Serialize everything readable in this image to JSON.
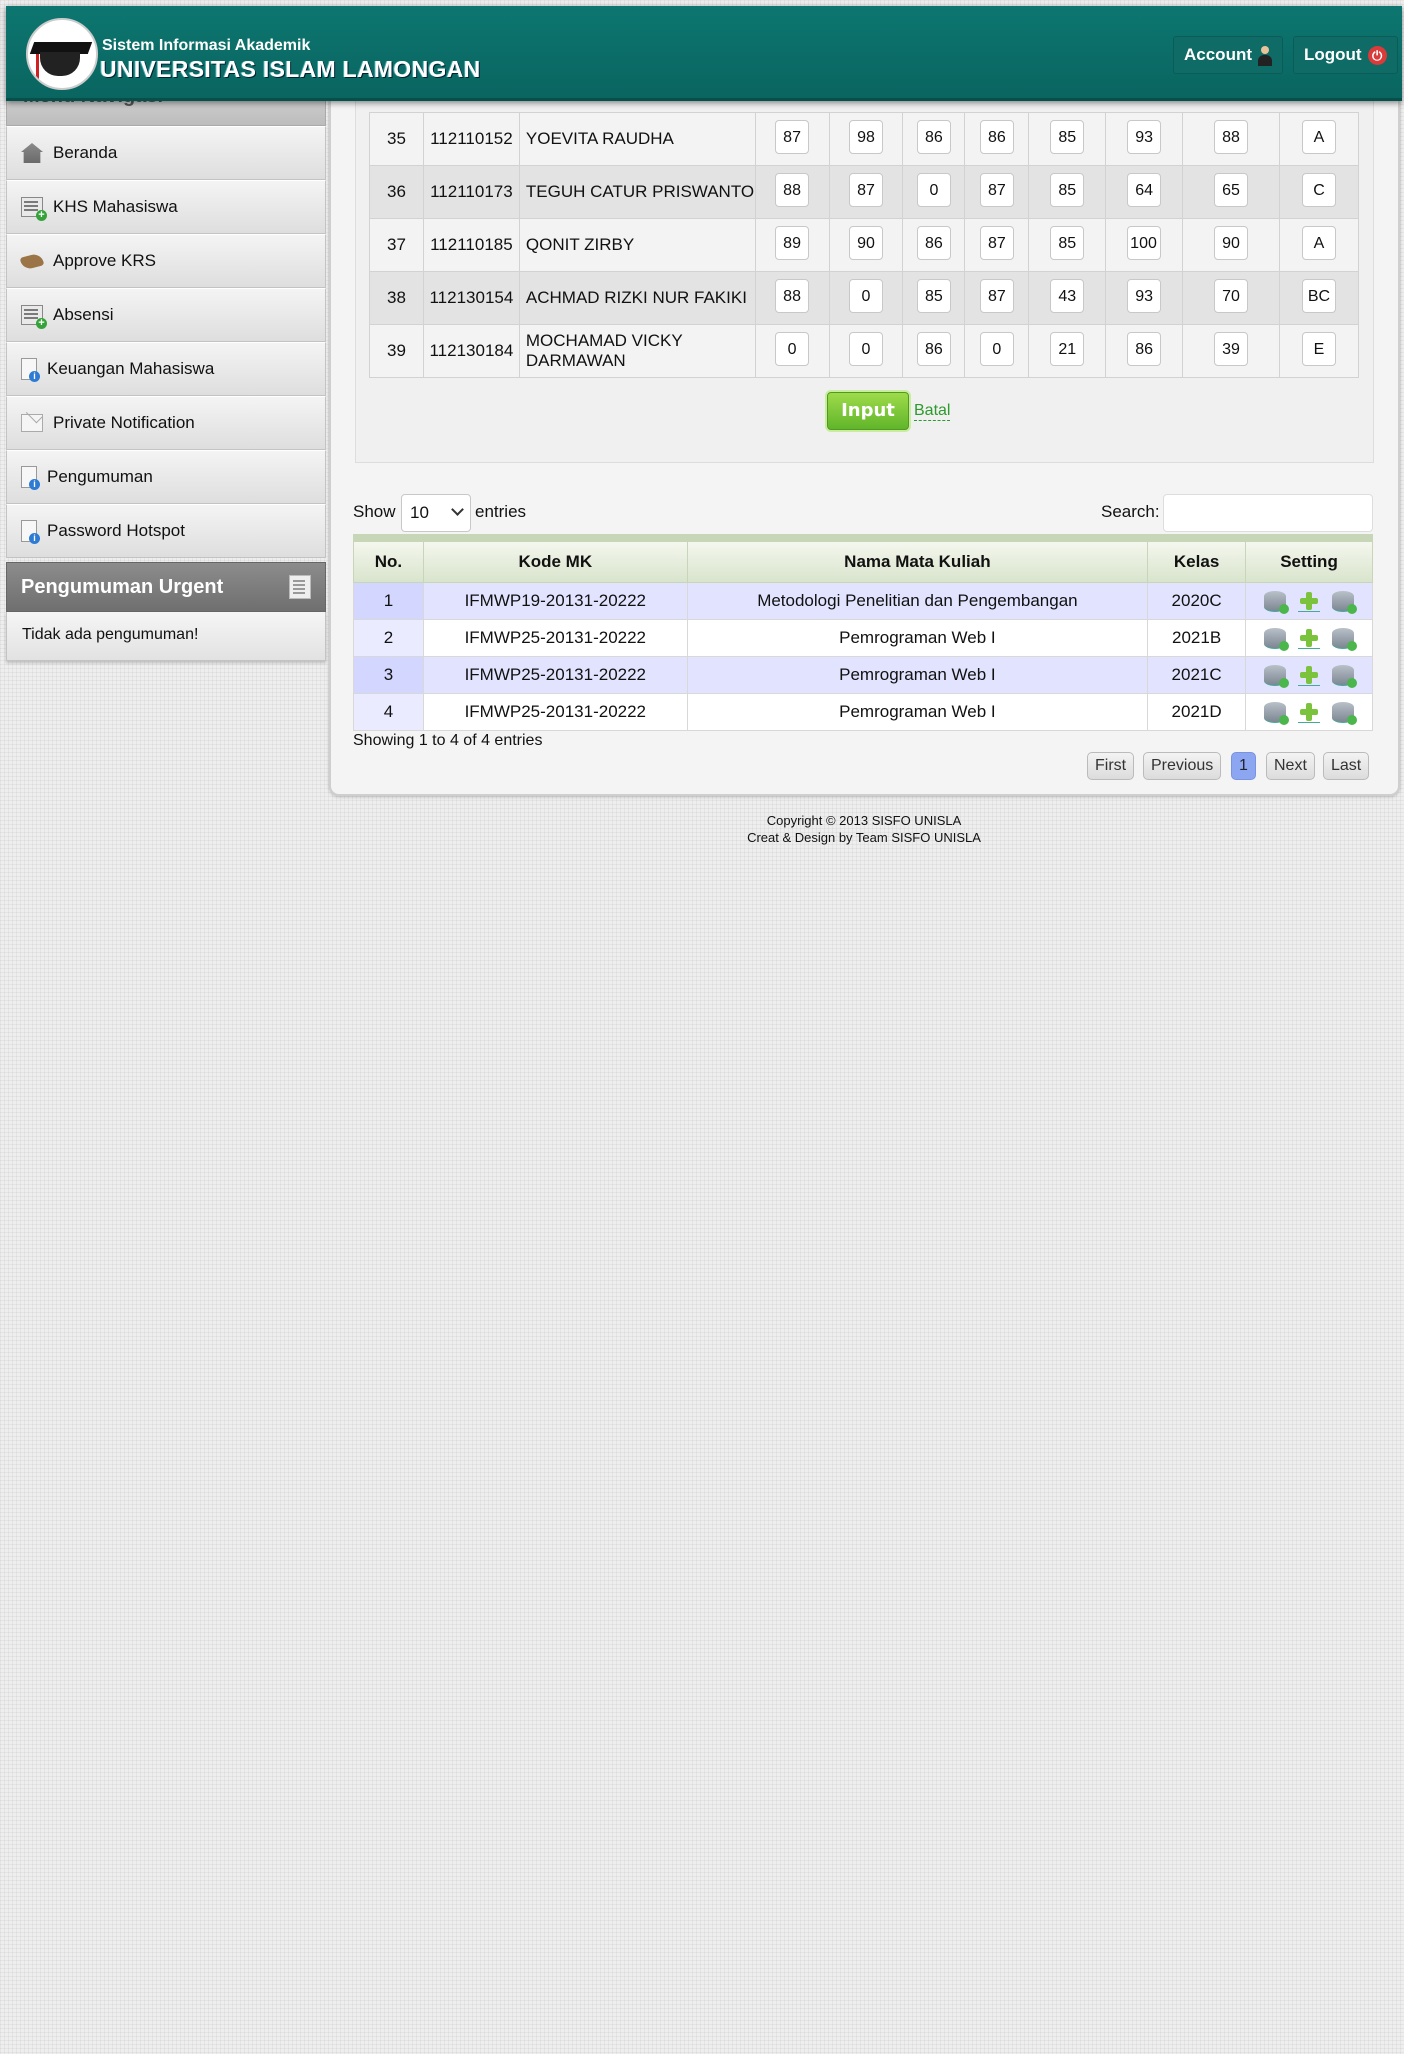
{
  "header": {
    "subtitle": "Sistem Informasi Akademik",
    "title": "UNIVERSITAS ISLAM LAMONGAN",
    "account_label": "Account",
    "logout_label": "Logout"
  },
  "sidebar": {
    "nav_title": "Menu Navigasi",
    "items": [
      {
        "label": "Beranda",
        "icon": "home-icon"
      },
      {
        "label": "KHS Mahasiswa",
        "icon": "calendar-add-icon"
      },
      {
        "label": "Approve KRS",
        "icon": "handshake-icon"
      },
      {
        "label": "Absensi",
        "icon": "calendar-add-icon"
      },
      {
        "label": "Keuangan Mahasiswa",
        "icon": "document-info-icon"
      },
      {
        "label": "Private Notification",
        "icon": "mail-icon"
      },
      {
        "label": "Pengumuman",
        "icon": "document-info-icon"
      },
      {
        "label": "Password Hotspot",
        "icon": "document-info-icon"
      }
    ],
    "urgent_title": "Pengumuman Urgent",
    "urgent_text": "Tidak ada pengumuman!"
  },
  "grades": {
    "rows": [
      {
        "no": "35",
        "nim": "112110152",
        "name": "YOEVITA RAUDHA",
        "scores": [
          "87",
          "98",
          "86",
          "86",
          "85",
          "93",
          "88",
          "A"
        ]
      },
      {
        "no": "36",
        "nim": "112110173",
        "name": "TEGUH CATUR PRISWANTO",
        "scores": [
          "88",
          "87",
          "0",
          "87",
          "85",
          "64",
          "65",
          "C"
        ]
      },
      {
        "no": "37",
        "nim": "112110185",
        "name": "QONIT ZIRBY",
        "scores": [
          "89",
          "90",
          "86",
          "87",
          "85",
          "100",
          "90",
          "A"
        ]
      },
      {
        "no": "38",
        "nim": "112130154",
        "name": "ACHMAD RIZKI NUR FAKIKI",
        "scores": [
          "88",
          "0",
          "85",
          "87",
          "43",
          "93",
          "70",
          "BC"
        ]
      },
      {
        "no": "39",
        "nim": "112130184",
        "name": "MOCHAMAD VICKY DARMAWAN",
        "scores": [
          "0",
          "0",
          "86",
          "0",
          "21",
          "86",
          "39",
          "E"
        ]
      }
    ],
    "input_button": "Input",
    "cancel_link": "Batal"
  },
  "datatable": {
    "show_label": "Show",
    "page_size": "10",
    "entries_label": "entries",
    "search_label": "Search:",
    "search_value": "",
    "columns": [
      "No.",
      "Kode MK",
      "Nama Mata Kuliah",
      "Kelas",
      "Setting"
    ],
    "rows": [
      {
        "no": "1",
        "kode": "IFMWP19-20131-20222",
        "nama": "Metodologi Penelitian dan Pengembangan",
        "kelas": "2020C"
      },
      {
        "no": "2",
        "kode": "IFMWP25-20131-20222",
        "nama": "Pemrograman Web I",
        "kelas": "2021B"
      },
      {
        "no": "3",
        "kode": "IFMWP25-20131-20222",
        "nama": "Pemrograman Web I",
        "kelas": "2021C"
      },
      {
        "no": "4",
        "kode": "IFMWP25-20131-20222",
        "nama": "Pemrograman Web I",
        "kelas": "2021D"
      }
    ],
    "info": "Showing 1 to 4 of 4 entries",
    "pagination": {
      "first": "First",
      "previous": "Previous",
      "current": "1",
      "next": "Next",
      "last": "Last"
    }
  },
  "footer": {
    "copyright": "Copyright © 2013 SISFO UNISLA",
    "credit": "Creat & Design by Team SISFO UNISLA"
  }
}
